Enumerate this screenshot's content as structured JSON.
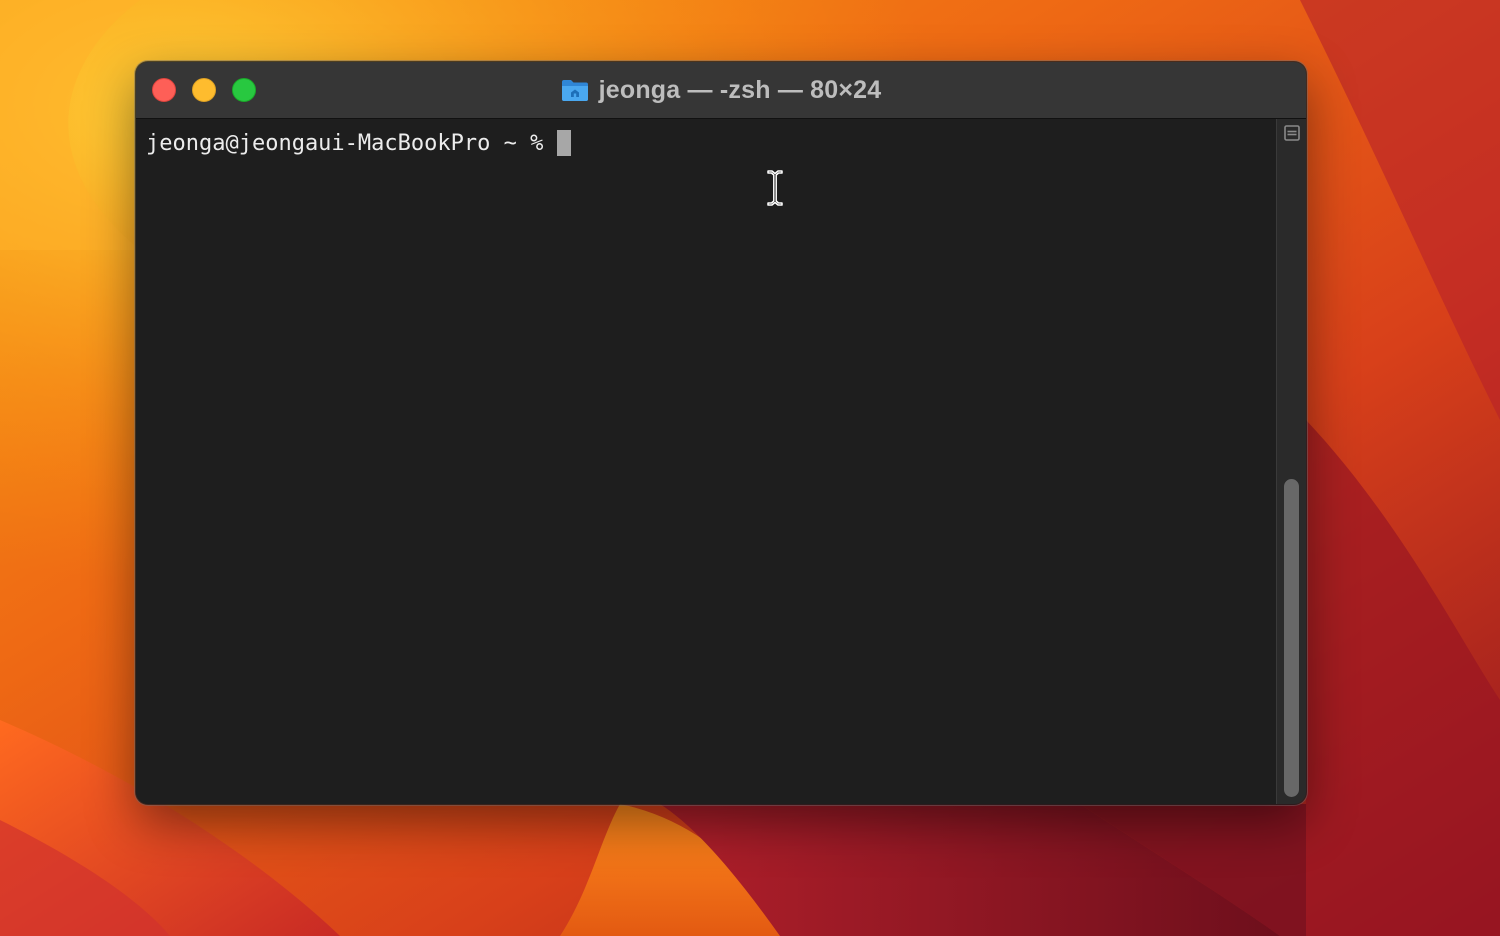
{
  "window": {
    "title": "jeonga — -zsh — 80×24"
  },
  "terminal": {
    "prompt": "jeonga@jeongaui-MacBookPro ~ %"
  },
  "icons": {
    "folder": "folder-icon",
    "split": "split-pane-icon",
    "pointer": "text-ibeam-cursor-icon"
  },
  "colors": {
    "close": "#fe5f57",
    "minimize": "#febc2e",
    "zoom": "#28c840",
    "terminal_background": "#1e1e1e",
    "titlebar": "#363636",
    "folder_blue": "#3a9be8"
  }
}
